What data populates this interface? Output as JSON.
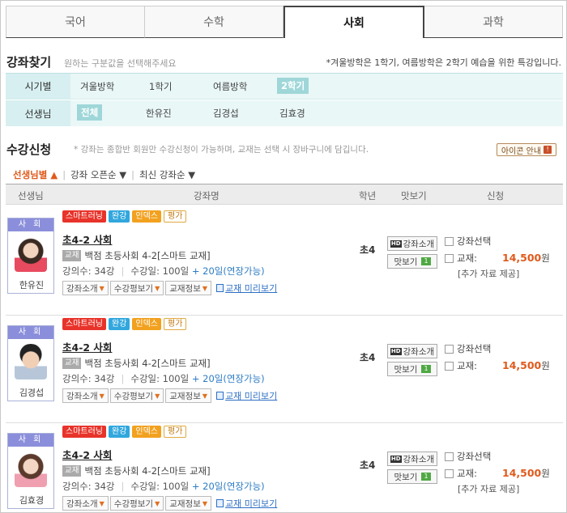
{
  "tabs": [
    {
      "label": "국어"
    },
    {
      "label": "수학"
    },
    {
      "label": "사회"
    },
    {
      "label": "과학"
    }
  ],
  "search": {
    "title": "강좌찾기",
    "subtitle": "원하는 구분값을 선택해주세요",
    "notice": "*겨울방학은 1학기, 여름방학은 2학기 예습을 위한 특강입니다.",
    "period": {
      "label": "시기별",
      "options": [
        "겨울방학",
        "1학기",
        "여름방학",
        "2학기"
      ]
    },
    "teacher": {
      "label": "선생님",
      "options": [
        "전체",
        "한유진",
        "김경섭",
        "김효경"
      ]
    }
  },
  "enroll": {
    "title": "수강신청",
    "note": "* 강좌는 종합반 회원만 수강신청이 가능하며, 교재는 선택 시 장바구니에 담깁니다.",
    "icon_guide": "아이콘 안내",
    "icon_guide_badge": "!",
    "sort": [
      "선생님별",
      "강좌 오픈순",
      "최신 강좌순"
    ],
    "sort_sep": "|",
    "headers": {
      "teacher": "선생님",
      "course": "강좌명",
      "grade": "학년",
      "preview": "맛보기",
      "apply": "신청"
    }
  },
  "badges": {
    "smart": "스마트러닝",
    "full": "완강",
    "index": "인덱스",
    "eval": "평가"
  },
  "labels": {
    "book_tag": "교재",
    "lectures_label": "강의수:",
    "period_label": "수강일:",
    "extension": "+ 20일(연장가능)",
    "course_intro": "강좌소개",
    "review": "수강평보기",
    "book_info": "교재정보",
    "book_preview": "교재 미리보기",
    "hd_intro": "강좌소개",
    "hd_icon": "HD",
    "taste": "맛보기",
    "taste_num": "1",
    "select_course": "강좌선택",
    "book_label": "교재:",
    "won": "원",
    "extra_material": "[추가 자료 제공]"
  },
  "courses": [
    {
      "subject": "사 회",
      "teacher": "한유진",
      "title": "초4-2 사회",
      "book": "백점 초등사회 4-2[스마트 교재]",
      "lectures": "34강",
      "days": "100일",
      "grade": "초4",
      "price": "14,500",
      "extra": true
    },
    {
      "subject": "사 회",
      "teacher": "김경섭",
      "title": "초4-2 사회",
      "book": "백점 초등사회 4-2[스마트 교재]",
      "lectures": "34강",
      "days": "100일",
      "grade": "초4",
      "price": "14,500",
      "extra": false
    },
    {
      "subject": "사 회",
      "teacher": "김효경",
      "title": "초4-2 사회",
      "book": "백점 초등사회 4-2[스마트 교재]",
      "lectures": "34강",
      "days": "100일",
      "grade": "초4",
      "price": "14,500",
      "extra": true
    }
  ]
}
